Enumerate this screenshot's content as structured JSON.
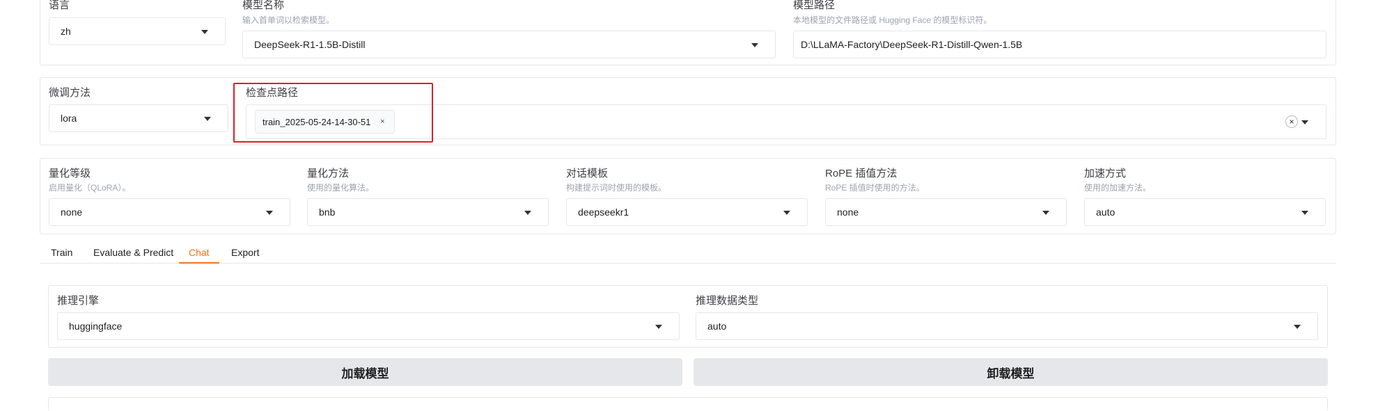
{
  "row1": {
    "language_label": "语言",
    "language_value": "zh",
    "model_name_label": "模型名称",
    "model_name_hint": "输入首单词以检索模型。",
    "model_name_value": "DeepSeek-R1-1.5B-Distill",
    "model_path_label": "模型路径",
    "model_path_hint": "本地模型的文件路径或 Hugging Face 的模型标识符。",
    "model_path_value": "D:\\LLaMA-Factory\\DeepSeek-R1-Distill-Qwen-1.5B"
  },
  "row2": {
    "finetune_label": "微调方法",
    "finetune_value": "lora",
    "checkpoint_label": "检查点路径",
    "checkpoint_chip": "train_2025-05-24-14-30-51",
    "chip_close": "×",
    "clear_symbol": "×"
  },
  "row3": {
    "quant_bit_label": "量化等级",
    "quant_bit_hint": "启用量化（QLoRA）。",
    "quant_bit_value": "none",
    "quant_method_label": "量化方法",
    "quant_method_hint": "使用的量化算法。",
    "quant_method_value": "bnb",
    "template_label": "对话模板",
    "template_hint": "构建提示词时使用的模板。",
    "template_value": "deepseekr1",
    "rope_label": "RoPE 插值方法",
    "rope_hint": "RoPE 插值时使用的方法。",
    "rope_value": "none",
    "booster_label": "加速方式",
    "booster_hint": "使用的加速方法。",
    "booster_value": "auto"
  },
  "tabs": [
    "Train",
    "Evaluate & Predict",
    "Chat",
    "Export"
  ],
  "active_tab": "Chat",
  "chat": {
    "infer_backend_label": "推理引擎",
    "infer_backend_value": "huggingface",
    "infer_dtype_label": "推理数据类型",
    "infer_dtype_value": "auto",
    "load_button": "加载模型",
    "unload_button": "卸载模型"
  },
  "colors": {
    "accent": "#f97316",
    "highlight_box": "#e11d28",
    "button_bg": "#e5e7eb",
    "border": "#e5e7eb"
  }
}
